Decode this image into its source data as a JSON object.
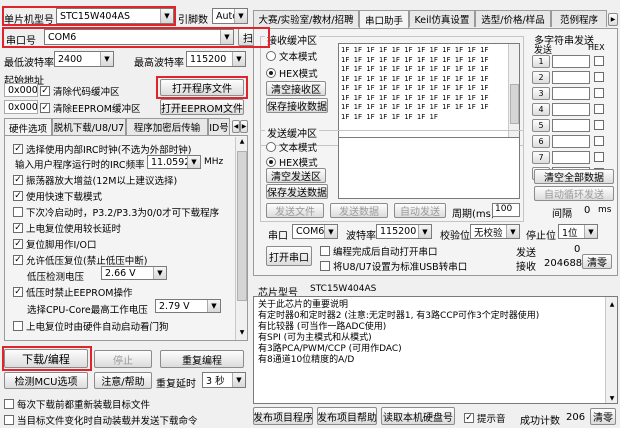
{
  "left": {
    "mcu_model_label": "单片机型号",
    "mcu_model_value": "STC15W404AS",
    "pin_count_label": "引脚数",
    "pin_count_value": "Auto",
    "port_label": "串口号",
    "port_value": "COM6",
    "scan_button": "扫描",
    "min_baud_label": "最低波特率",
    "min_baud_value": "2400",
    "max_baud_label": "最高波特率",
    "max_baud_value": "115200",
    "start_addr_label": "起始地址",
    "addr1_value": "0x0000",
    "clear_code_buffer": "清除代码缓冲区",
    "open_program_file": "打开程序文件",
    "addr2_value": "0x0000",
    "clear_eeprom_buffer": "清除EEPROM缓冲区",
    "open_eeprom_file": "打开EEPROM文件",
    "tabs": [
      "硬件选项",
      "脱机下载/U8/U7",
      "程序加密后传输",
      "ID号"
    ],
    "options": [
      {
        "label": "选择使用内部IRC时钟(不选为外部时钟)",
        "checked": true
      },
      {
        "label": "使用快速下载模式",
        "checked": true
      },
      {
        "label": "下次冷启动时，P3.2/P3.3为0/0才可下载程序",
        "checked": false
      },
      {
        "label": "上电复位使用较长延时",
        "checked": true
      },
      {
        "label": "复位脚用作I/O口",
        "checked": true
      },
      {
        "label": "允许低压复位(禁止低压中断)",
        "checked": true
      },
      {
        "label": "低压时禁止EEPROM操作",
        "checked": true
      },
      {
        "label": "上电复位时由硬件自动启动看门狗",
        "checked": false
      }
    ],
    "irc_freq_label": "输入用户程序运行时的IRC频率",
    "irc_freq_value": "11.0592",
    "irc_freq_unit": "MHz",
    "osc_gain_label": "振荡器放大增益(12M以上建议选择)",
    "osc_gain_checked": true,
    "lvd_label": "低压检测电压",
    "lvd_value": "2.66 V",
    "cpu_core_label": "选择CPU-Core最高工作电压",
    "cpu_core_value": "2.79 V",
    "download_button": "下载/编程",
    "stop_button": "停止",
    "reprogram_button": "重复编程",
    "detect_mcu_button": "检测MCU选项",
    "help_button": "注意/帮助",
    "repeat_delay_label": "重复延时",
    "repeat_delay_value": "3 秒",
    "reload_each_time": "每次下载前都重新装载目标文件",
    "auto_load_on_change": "当目标文件变化时自动装载并发送下载命令"
  },
  "right": {
    "tabs": [
      "大赛/实验室/教材/招聘",
      "串口助手",
      "Keil仿真设置",
      "选型/价格/样品",
      "范例程序"
    ],
    "recv_title": "接收缓冲区",
    "text_mode": "文本模式",
    "hex_mode": "HEX模式",
    "clear_recv": "清空接收区",
    "save_recv": "保存接收数据",
    "recv_lines": [
      "1F 1F 1F 1F 1F 1F 1F 1F 1F 1F 1F 1F",
      "1F 1F 1F 1F 1F 1F 1F 1F 1F 1F 1F 1F",
      "1F 1F 1F 1F 1F 1F 1F 1F 1F 1F 1F 1F",
      "1F 1F 1F 1F 1F 1F 1F 1F 1F 1F 1F 1F",
      "1F 1F 1F 1F 1F 1F 1F 1F 1F 1F 1F 1F",
      "1F 1F 1F 1F 1F 1F 1F 1F 1F 1F 1F 1F",
      "1F 1F 1F 1F 1F 1F 1F 1F 1F 1F 1F 1F",
      "1F 1F 1F 1F 1F 1F 1F 1F"
    ],
    "multi_title": "多字符串发送",
    "send_col": "发送",
    "hex_col": "HEX",
    "multi_rows": [
      "1",
      "2",
      "3",
      "4",
      "5",
      "6",
      "7",
      "8"
    ],
    "send_title": "发送缓冲区",
    "clear_send": "清空发送区",
    "save_send": "保存发送数据",
    "send_file": "发送文件",
    "send_data": "发送数据",
    "auto_send": "自动发送",
    "period_label": "周期(ms)",
    "period_value": "100",
    "clear_all": "清空全部数据",
    "auto_loop": "自动循环发送",
    "interval_label": "间隔",
    "interval_value": "0",
    "interval_unit": "ms",
    "port_label": "串口",
    "port_value": "COM6",
    "baud_label": "波特率",
    "baud_value": "115200",
    "parity_label": "校验位",
    "parity_value": "无校验",
    "stop_label": "停止位",
    "stop_value": "1位",
    "open_port": "打开串口",
    "open_after_download": "编程完成后自动打开串口",
    "usb_cdc": "将U8/U7设置为标准USB转串口",
    "send_count_label": "发送",
    "send_count": "0",
    "recv_count_label": "接收",
    "recv_count": "204688",
    "clear_count": "清零",
    "chip_label": "芯片型号",
    "chip_value": "STC15W404AS",
    "info_lines": [
      "关于此芯片的重要说明",
      "有定时器0和定时器2 (注意:无定时器1, 有3路CCP可作3个定时器使用)",
      "有比较器 (可当作一路ADC使用)",
      "有SPI (可为主模式和从模式)",
      "有3路PCA/PWM/CCP (可用作DAC)",
      "有8通道10位精度的A/D"
    ],
    "publish_program": "发布项目程序",
    "publish_help": "发布项目帮助",
    "read_disk_id": "读取本机硬盘号",
    "beep_label": "提示音",
    "success_label": "成功计数",
    "success_count": "206",
    "clear_success": "清零"
  },
  "colors": {
    "highlight": "#e0242c"
  }
}
